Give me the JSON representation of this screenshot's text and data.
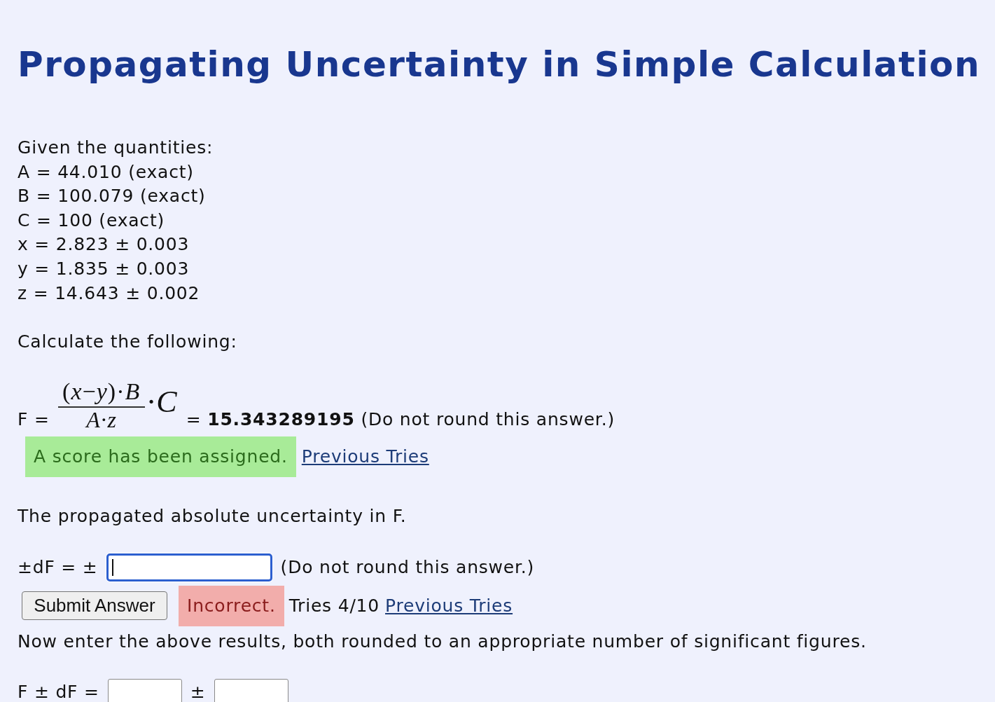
{
  "page": {
    "title": "Propagating Uncertainty in Simple Calculation"
  },
  "given": {
    "heading": "Given the quantities:",
    "lines": [
      "A = 44.010 (exact)",
      "B = 100.079 (exact)",
      "C = 100 (exact)",
      "x = 2.823 ± 0.003",
      "y = 1.835 ± 0.003",
      "z = 14.643 ± 0.002"
    ]
  },
  "task": {
    "heading": "Calculate the following:"
  },
  "question_1": {
    "label": "F =",
    "numerator": "(*x*−*y*)·*B*",
    "denominator": "*A*·*z*",
    "factor": "·*C*",
    "answer": "= **15.343289195** (Do not round this answer.)",
    "feedback": {
      "kind": "success",
      "text": "A score has been assigned."
    },
    "link": "Previous Tries"
  },
  "question_2": {
    "prompt": "The propagated absolute uncertainty in F.",
    "label": "±dF = ±",
    "field": {
      "focused": true
    },
    "note": "(Do not round this answer.)",
    "submit_button": "Submit Answer",
    "feedback": {
      "kind": "error",
      "text": "Incorrect."
    },
    "tries": "Tries 4/10",
    "link": "Previous Tries"
  },
  "question_3": {
    "prompt": "Now enter the above results, both rounded to an appropriate number of significant figures.",
    "label": "F ± dF =",
    "fields": [
      {
        "focused": false
      },
      {
        "focused": false
      }
    ],
    "separator": "±"
  }
}
